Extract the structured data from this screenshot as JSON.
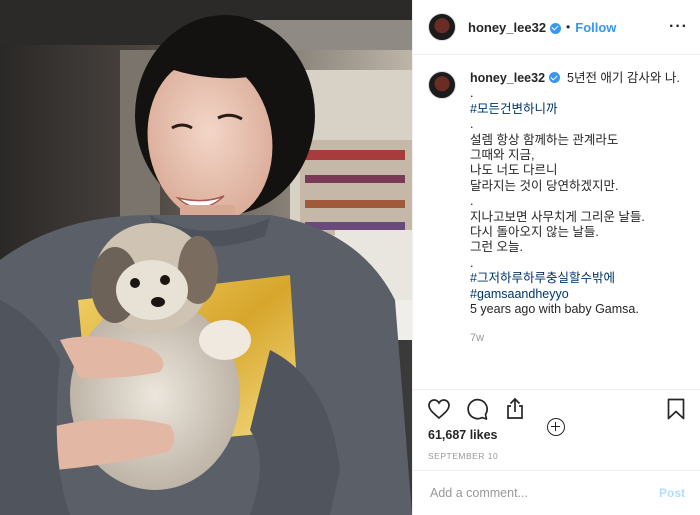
{
  "post": {
    "username": "honey_lee32",
    "follow_label": "Follow",
    "dot": "•",
    "more_label": "···"
  },
  "caption": {
    "username": "honey_lee32",
    "lines": [
      "5년전 애기 감사와 나.",
      ".",
      "#모든건변하니까",
      ".",
      "설렘 항상 함께하는 관계라도",
      "그때와 지금,",
      "나도 너도 다르니",
      "달라지는 것이 당연하겠지만.",
      ".",
      "지나고보면 사무치게 그리운 날들.",
      "다시 돌아오지 않는 날들.",
      "그런 오늘.",
      ".",
      "#그저하루하루충실할수밖에",
      "#gamsaandheyyo",
      "5 years ago with baby Gamsa."
    ],
    "hashtag_line_indices": [
      2,
      13,
      14
    ],
    "time_ago": "7w"
  },
  "stats": {
    "likes": "61,687 likes",
    "date": "SEPTEMBER 10"
  },
  "comment_box": {
    "placeholder": "Add a comment...",
    "post_label": "Post"
  },
  "icons": {
    "like": "heart-icon",
    "comment": "comment-icon",
    "share": "share-icon",
    "save": "bookmark-icon",
    "load_more": "plus-circle-icon"
  },
  "colors": {
    "link_blue": "#3897f0",
    "hashtag": "#003569",
    "muted": "#999999",
    "post_disabled": "#b2dffc"
  }
}
